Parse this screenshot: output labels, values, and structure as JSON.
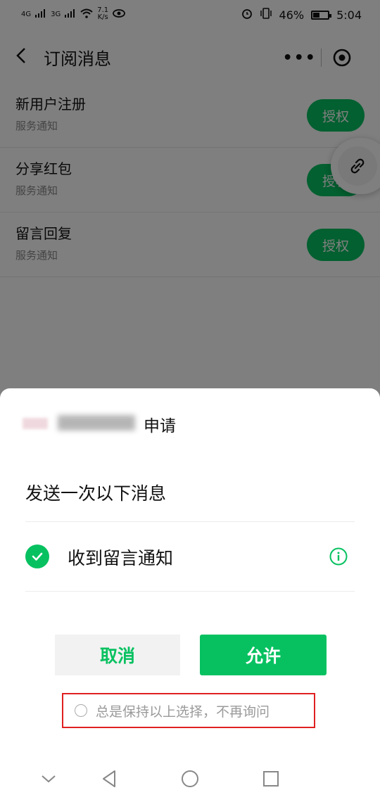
{
  "status_bar": {
    "network_left": "4G",
    "network_right": "3G",
    "speed_value": "7.1",
    "speed_unit": "K/s",
    "battery": "46%",
    "battery_level": 0.46,
    "time": "5:04",
    "icons": [
      "signal-icon",
      "wifi-icon",
      "eye-icon",
      "alarm-icon",
      "vibrate-icon",
      "battery-icon"
    ]
  },
  "navbar": {
    "title": "订阅消息",
    "more_label": "•••"
  },
  "subscriptions": [
    {
      "title": "新用户注册",
      "subtitle": "服务通知",
      "action": "授权"
    },
    {
      "title": "分享红包",
      "subtitle": "服务通知",
      "action": "授权"
    },
    {
      "title": "留言回复",
      "subtitle": "服务通知",
      "action": "授权"
    }
  ],
  "dialog": {
    "apply_suffix": "申请",
    "heading": "发送一次以下消息",
    "message_item": "收到留言通知",
    "cancel_label": "取消",
    "allow_label": "允许",
    "remember_label": "总是保持以上选择，不再询问"
  },
  "colors": {
    "accent": "#07c160",
    "highlight_border": "#e02020"
  }
}
